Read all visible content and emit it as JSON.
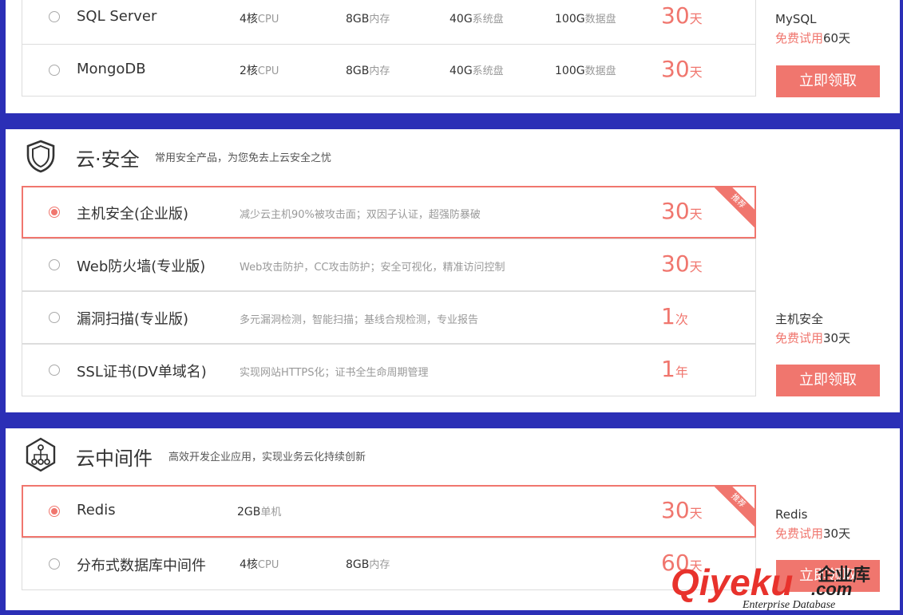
{
  "database": {
    "rows": [
      {
        "name": "SQL Server",
        "cpu_num": "4核",
        "cpu_unit": "CPU",
        "mem_num": "8GB",
        "mem_unit": "内存",
        "sys_num": "40G",
        "sys_unit": "系统盘",
        "data_num": "100G",
        "data_unit": "数据盘",
        "price_num": "30",
        "price_unit": "天"
      },
      {
        "name": "MongoDB",
        "cpu_num": "2核",
        "cpu_unit": "CPU",
        "mem_num": "8GB",
        "mem_unit": "内存",
        "sys_num": "40G",
        "sys_unit": "系统盘",
        "data_num": "100G",
        "data_unit": "数据盘",
        "price_num": "30",
        "price_unit": "天"
      }
    ],
    "side": {
      "product": "MySQL",
      "trial_label": "免费试用",
      "trial_days": "60天",
      "button": "立即领取"
    }
  },
  "security": {
    "icon": "shield-icon",
    "title": "云·安全",
    "subtitle": "常用安全产品，为您免去上云安全之忧",
    "rows": [
      {
        "name": "主机安全(企业版)",
        "desc": "减少云主机90%被攻击面；双因子认证，超强防暴破",
        "price_num": "30",
        "price_unit": "天",
        "selected": true,
        "tag": "推荐"
      },
      {
        "name": "Web防火墙(专业版)",
        "desc": "Web攻击防护，CC攻击防护；安全可视化，精准访问控制",
        "price_num": "30",
        "price_unit": "天"
      },
      {
        "name": "漏洞扫描(专业版)",
        "desc": "多元漏洞检测，智能扫描；基线合规检测，专业报告",
        "price_num": "1",
        "price_unit": "次"
      },
      {
        "name": "SSL证书(DV单域名)",
        "desc": "实现网站HTTPS化；证书全生命周期管理",
        "price_num": "1",
        "price_unit": "年"
      }
    ],
    "side": {
      "product": "主机安全",
      "trial_label": "免费试用",
      "trial_days": "30天",
      "button": "立即领取"
    }
  },
  "middleware": {
    "icon": "network-nodes-icon",
    "title": "云中间件",
    "subtitle": "高效开发企业应用，实现业务云化持续创新",
    "rows": [
      {
        "name": "Redis",
        "spec_num": "2GB",
        "spec_unit": "单机",
        "price_num": "30",
        "price_unit": "天",
        "selected": true,
        "tag": "推荐"
      },
      {
        "name": "分布式数据库中间件",
        "cpu_num": "4核",
        "cpu_unit": "CPU",
        "mem_num": "8GB",
        "mem_unit": "内存",
        "price_num": "60",
        "price_unit": "天"
      }
    ],
    "side": {
      "product": "Redis",
      "trial_label": "免费试用",
      "trial_days": "30天",
      "button": "立即领取"
    }
  },
  "watermark": {
    "brand": "Qiyeku",
    "domain": ".com",
    "cn": "企业库",
    "en": "Enterprise Database"
  },
  "colors": {
    "accent": "#f0766e",
    "background": "#2b2fb6"
  }
}
